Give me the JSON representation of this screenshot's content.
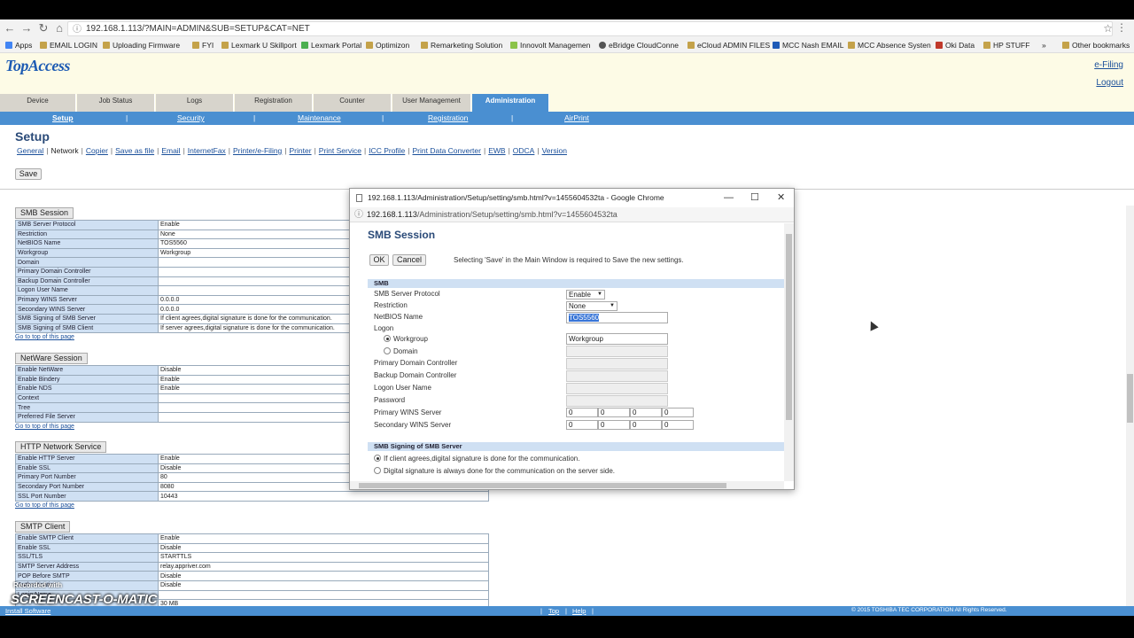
{
  "browser": {
    "url": "192.168.1.113/?MAIN=ADMIN&SUB=SETUP&CAT=NET",
    "bookmarks": [
      "Apps",
      "EMAIL LOGIN",
      "Uploading Firmware",
      "FYI",
      "Lexmark U Skillport",
      "Lexmark Portal",
      "Optimizon",
      "Remarketing Solution",
      "Innovolt Managemen",
      "eBridge CloudConne",
      "eCloud ADMIN FILES",
      "MCC Nash EMAIL",
      "MCC Absence Systen",
      "Oki Data",
      "HP STUFF",
      "»",
      "Other bookmarks"
    ]
  },
  "header": {
    "logo": "TopAccess",
    "efiling": "e-Filing",
    "logout": "Logout"
  },
  "main_tabs": [
    "Device",
    "Job Status",
    "Logs",
    "Registration",
    "Counter",
    "User Management",
    "Administration"
  ],
  "sub_tabs": [
    "Setup",
    "Security",
    "Maintenance",
    "Registration",
    "AirPrint"
  ],
  "page": {
    "title": "Setup",
    "links": [
      "General",
      "Network",
      "Copier",
      "Save as file",
      "Email",
      "InternetFax",
      "Printer/e-Filing",
      "Printer",
      "Print Service",
      "ICC Profile",
      "Print Data Converter",
      "EWB",
      "ODCA",
      "Version"
    ],
    "save_label": "Save",
    "goto_top": "Go to top of this page"
  },
  "sections": [
    {
      "title": "SMB Session",
      "rows": [
        [
          "SMB Server Protocol",
          "Enable"
        ],
        [
          "Restriction",
          "None"
        ],
        [
          "NetBIOS Name",
          "TOS5560"
        ],
        [
          "Workgroup",
          "Workgroup"
        ],
        [
          "Domain",
          ""
        ],
        [
          "Primary Domain Controller",
          ""
        ],
        [
          "Backup Domain Controller",
          ""
        ],
        [
          "Logon User Name",
          ""
        ],
        [
          "Primary WINS Server",
          "0.0.0.0"
        ],
        [
          "Secondary WINS Server",
          "0.0.0.0"
        ],
        [
          "SMB Signing of SMB Server",
          "If client agrees,digital signature is done for the communication."
        ],
        [
          "SMB Signing of SMB Client",
          "If server agrees,digital signature is done for the communication."
        ]
      ]
    },
    {
      "title": "NetWare Session",
      "rows": [
        [
          "Enable NetWare",
          "Disable"
        ],
        [
          "Enable Bindery",
          "Enable"
        ],
        [
          "Enable NDS",
          "Enable"
        ],
        [
          "Context",
          ""
        ],
        [
          "Tree",
          ""
        ],
        [
          "Preferred File Server",
          ""
        ]
      ]
    },
    {
      "title": "HTTP Network Service",
      "rows": [
        [
          "Enable HTTP Server",
          "Enable"
        ],
        [
          "Enable SSL",
          "Disable"
        ],
        [
          "Primary Port Number",
          "80"
        ],
        [
          "Secondary Port Number",
          "8080"
        ],
        [
          "SSL Port Number",
          "10443"
        ]
      ]
    },
    {
      "title": "SMTP Client",
      "rows": [
        [
          "Enable SMTP Client",
          "Enable"
        ],
        [
          "Enable SSL",
          "Disable"
        ],
        [
          "SSL/TLS",
          "STARTTLS"
        ],
        [
          "SMTP Server Address",
          "relay.appriver.com"
        ],
        [
          "POP Before SMTP",
          "Disable"
        ],
        [
          "Authentication",
          "Disable"
        ],
        [
          "Login Name",
          ""
        ],
        [
          "",
          "30  MB"
        ]
      ]
    }
  ],
  "footer": {
    "install": "Install Software",
    "top": "Top",
    "help": "Help",
    "copyright": "© 2015 TOSHIBA TEC CORPORATION All Rights Reserved."
  },
  "watermark": {
    "line1": "Recorded with",
    "line2": "SCREENCAST-O-MATIC"
  },
  "popup": {
    "window_title": "192.168.1.113/Administration/Setup/setting/smb.html?v=1455604532ta - Google Chrome",
    "url_host": "192.168.1.113",
    "url_path": "/Administration/Setup/setting/smb.html?v=1455604532ta",
    "title": "SMB Session",
    "ok_label": "OK",
    "cancel_label": "Cancel",
    "note": "Selecting 'Save' in the Main Window is required to Save the new settings.",
    "smb_header": "SMB",
    "labels": {
      "protocol": "SMB Server Protocol",
      "restriction": "Restriction",
      "netbios": "NetBIOS Name",
      "logon": "Logon",
      "workgroup": "Workgroup",
      "domain": "Domain",
      "pdc": "Primary Domain Controller",
      "bdc": "Backup Domain Controller",
      "logon_user": "Logon User Name",
      "password": "Password",
      "pwins": "Primary WINS Server",
      "swins": "Secondary WINS Server"
    },
    "values": {
      "protocol": "Enable",
      "restriction": "None",
      "netbios": "TOS5560",
      "workgroup": "Workgroup",
      "ip0": "0"
    },
    "signing_header": "SMB Signing of SMB Server",
    "signing_opt1": "If client agrees,digital signature is done for the communication.",
    "signing_opt2": "Digital signature is always done for the communication on the server side."
  }
}
